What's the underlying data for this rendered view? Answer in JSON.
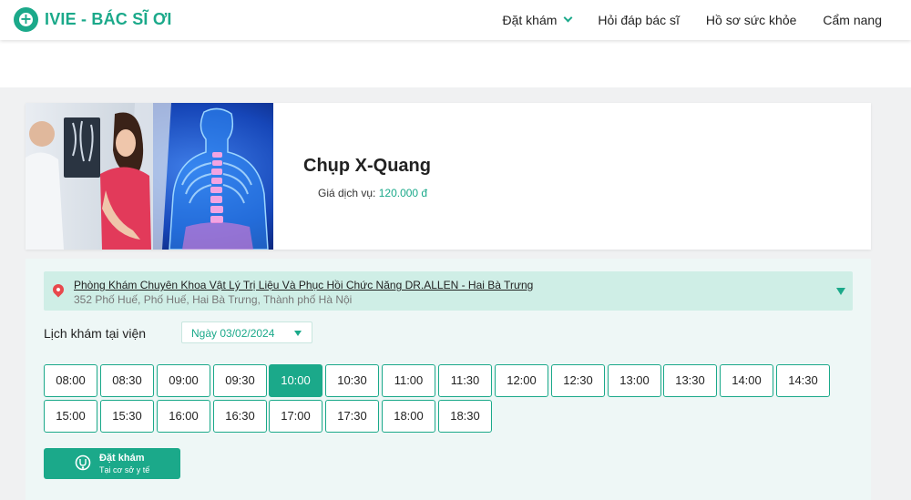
{
  "header": {
    "logo_text": "IVIE - BÁC SĨ ƠI",
    "nav": [
      {
        "label": "Đặt khám",
        "has_dropdown": true
      },
      {
        "label": "Hỏi đáp bác sĩ"
      },
      {
        "label": "Hồ sơ sức khỏe"
      },
      {
        "label": "Cẩm nang"
      }
    ]
  },
  "service": {
    "title": "Chụp X-Quang",
    "price_label": "Giá dịch vụ:",
    "price_value": "120.000 đ"
  },
  "clinic": {
    "name": "Phòng Khám Chuyên Khoa Vật Lý Trị Liệu Và Phục Hồi Chức Năng DR.ALLEN - Hai Bà Trưng",
    "address": "352 Phố Huế, Phố Huế, Hai Bà Trưng, Thành phố Hà Nội"
  },
  "schedule": {
    "label": "Lịch khám tại viện",
    "date": "Ngày 03/02/2024",
    "selected_slot": "10:00",
    "slots": [
      "08:00",
      "08:30",
      "09:00",
      "09:30",
      "10:00",
      "10:30",
      "11:00",
      "11:30",
      "12:00",
      "12:30",
      "13:00",
      "13:30",
      "14:00",
      "14:30",
      "15:00",
      "15:30",
      "16:00",
      "16:30",
      "17:00",
      "17:30",
      "18:00",
      "18:30"
    ]
  },
  "book_button": {
    "title": "Đặt khám",
    "subtitle": "Tại cơ sở y tế"
  },
  "colors": {
    "brand": "#1ba98a",
    "clinic_bar": "#cfeee6",
    "pin": "#e8484c"
  }
}
